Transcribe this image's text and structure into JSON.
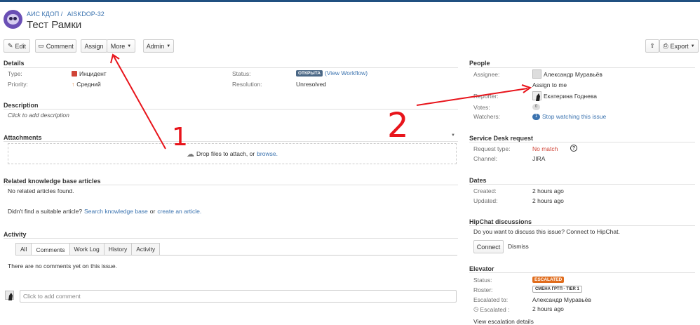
{
  "header": {
    "project": "АИС КДОП /",
    "issue_key": "AISKDOP-32",
    "title": "Тест Рамки"
  },
  "toolbar": {
    "edit": "Edit",
    "comment": "Comment",
    "assign": "Assign",
    "more": "More",
    "admin": "Admin",
    "export": "Export"
  },
  "details": {
    "title": "Details",
    "type_label": "Type:",
    "type_value": "Инцидент",
    "priority_label": "Priority:",
    "priority_value": "Средний",
    "status_label": "Status:",
    "status_value": "ОТКРЫТА",
    "workflow_link": "(View Workflow)",
    "resolution_label": "Resolution:",
    "resolution_value": "Unresolved"
  },
  "description": {
    "title": "Description",
    "placeholder": "Click to add description"
  },
  "attachments": {
    "title": "Attachments",
    "drop_text": "Drop files to attach, or",
    "browse": "browse."
  },
  "kb": {
    "title": "Related knowledge base articles",
    "none": "No related articles found.",
    "question": "Didn't find a suitable article?",
    "search_link": "Search knowledge base",
    "or": "or",
    "create_link": "create an article."
  },
  "activity": {
    "title": "Activity",
    "tabs": [
      "All",
      "Comments",
      "Work Log",
      "History",
      "Activity"
    ],
    "empty": "There are no comments yet on this issue.",
    "comment_placeholder": "Click to add comment"
  },
  "people": {
    "title": "People",
    "assignee_label": "Assignee:",
    "assignee_value": "Александр Муравьёв",
    "assign_to_me": "Assign to me",
    "reporter_label": "Reporter:",
    "reporter_value": "Екатерина Годнева",
    "votes_label": "Votes:",
    "votes_value": "0",
    "watchers_label": "Watchers:",
    "watchers_count": "1",
    "watchers_link": "Stop watching this issue"
  },
  "service_desk": {
    "title": "Service Desk request",
    "request_type_label": "Request type:",
    "request_type_value": "No match",
    "channel_label": "Channel:",
    "channel_value": "JIRA"
  },
  "dates": {
    "title": "Dates",
    "created_label": "Created:",
    "created_value": "2 hours ago",
    "updated_label": "Updated:",
    "updated_value": "2 hours ago"
  },
  "hipchat": {
    "title": "HipChat discussions",
    "question": "Do you want to discuss this issue? Connect to HipChat.",
    "connect": "Connect",
    "dismiss": "Dismiss"
  },
  "elevator": {
    "title": "Elevator",
    "status_label": "Status:",
    "status_value": "ESCALATED",
    "roster_label": "Roster:",
    "roster_value": "СМЕНА ГРТП - TIER 1",
    "escalated_to_label": "Escalated to:",
    "escalated_to_value": "Александр Муравьёв",
    "escalated_label": "Escalated :",
    "escalated_value": "2 hours ago",
    "details_link": "View escalation details"
  },
  "annotations": {
    "label_1": "1",
    "label_2": "2"
  },
  "colors": {
    "link": "#3b73af",
    "annotation": "#e8141b",
    "status_lozenge": "#4a6785",
    "escalated": "#e06c1c"
  }
}
